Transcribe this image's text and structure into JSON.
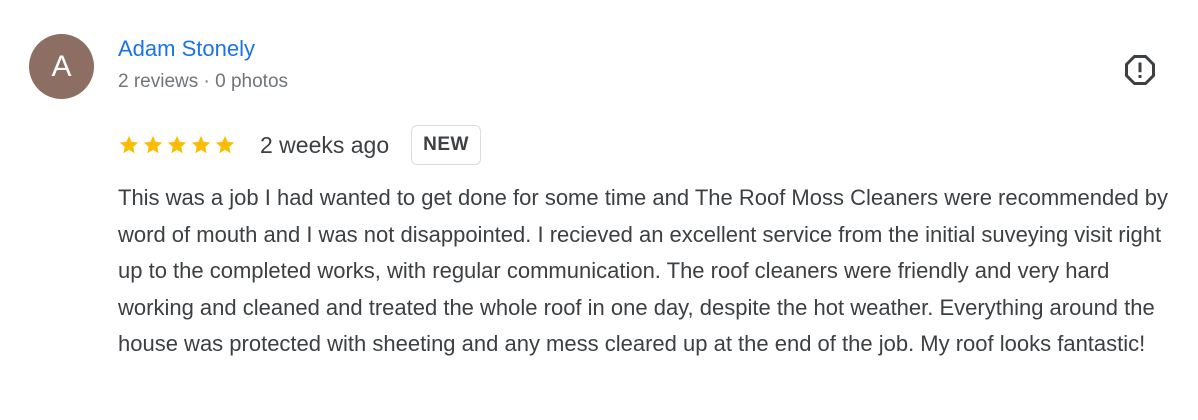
{
  "review": {
    "author": {
      "initial": "A",
      "name": "Adam Stonely",
      "meta": "2 reviews · 0 photos",
      "avatar_color": "#8d6e63"
    },
    "flag_icon": "report-flag-icon",
    "rating": 5,
    "rating_max": 5,
    "star_color": "#fbbc04",
    "date": "2 weeks ago",
    "badge": "NEW",
    "text": "This was a job I had wanted to get done for some time and The Roof Moss Cleaners were recommended by word of mouth and I was not disappointed. I recieved an excellent service from the initial suveying visit right up to the completed works, with regular communication. The roof cleaners were friendly and very hard working and cleaned and treated the whole roof in one day, despite the hot weather. Everything around the house was protected with sheeting and any mess cleared up at the end of the job. My roof looks fantastic!",
    "name_color": "#1a73e8"
  }
}
